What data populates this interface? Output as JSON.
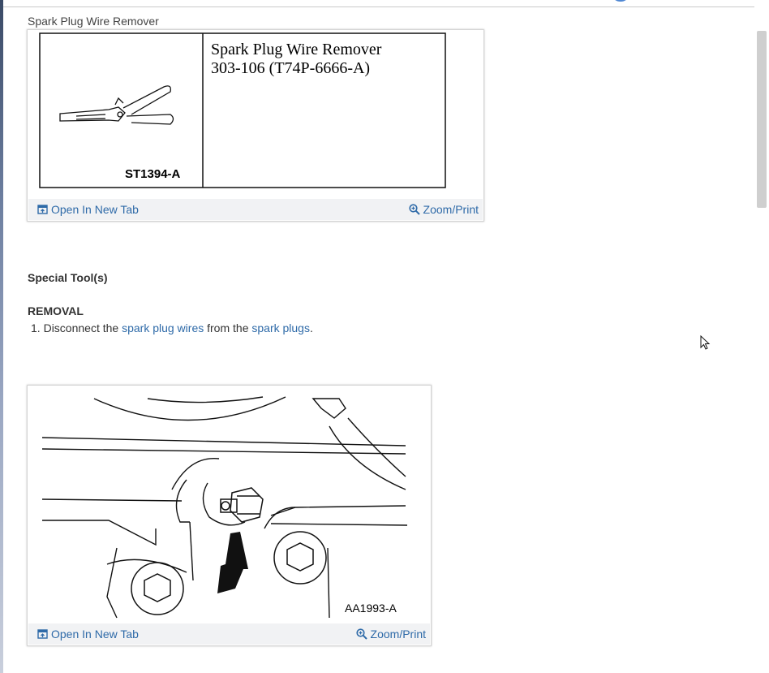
{
  "figure1": {
    "caption": "Spark Plug Wire Remover",
    "tool_name": "Spark Plug Wire Remover",
    "tool_number": "303-106 (T74P-6666-A)",
    "figure_id": "ST1394-A",
    "open_tab": "Open In New Tab",
    "zoom_print": "Zoom/Print"
  },
  "section_special_tools": "Special Tool(s)",
  "section_removal": "REMOVAL",
  "step1": {
    "number": "1.",
    "text_before": "Disconnect the",
    "link1": "spark plug wires",
    "text_middle": "from the",
    "link2": "spark plugs",
    "text_after": "."
  },
  "figure2": {
    "figure_id": "AA1993-A",
    "open_tab": "Open In New Tab",
    "zoom_print": "Zoom/Print"
  },
  "colors": {
    "link": "#2e6aa8",
    "card_footer": "#f1f2f4",
    "scroll_thumb": "#cfcfcf"
  }
}
